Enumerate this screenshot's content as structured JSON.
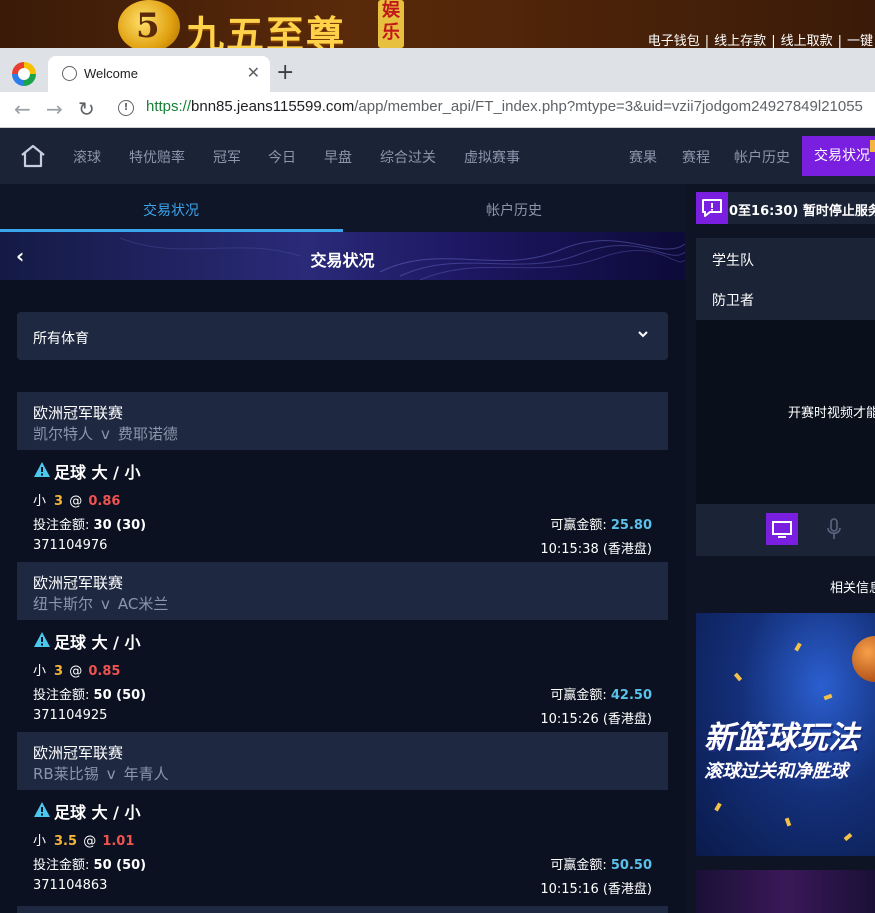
{
  "banner": {
    "logo_char": "5",
    "brand": "九五至尊",
    "brand_tag": [
      "娱",
      "乐"
    ],
    "links": [
      "电子钱包",
      "线上存款",
      "线上取款",
      "一键"
    ]
  },
  "browser": {
    "tab_title": "Welcome",
    "url_scheme": "https://",
    "url_host": "bnn85.jeans115599.com",
    "url_path": "/app/member_api/FT_index.php?mtype=3&uid=vzii7jodgom24927849l21055"
  },
  "nav": {
    "items": [
      "滚球",
      "特优赔率",
      "冠军",
      "今日",
      "早盘",
      "综合过关",
      "虚拟赛事"
    ],
    "right_items": [
      "赛果",
      "赛程",
      "帐户历史"
    ],
    "active": "交易状况"
  },
  "subtabs": {
    "active": "交易状况",
    "other": "帐户历史"
  },
  "page_title": "交易状况",
  "sport_filter": {
    "selected": "所有体育"
  },
  "bets": [
    {
      "league": "欧洲冠军联赛",
      "home": "凯尔特人",
      "vs": "v",
      "away": "费耶诺德",
      "market": "足球 大 / 小",
      "selection": "小",
      "handicap": "3",
      "at": "@",
      "odds": "0.86",
      "stake_label": "投注金额:",
      "stake": "30 (30)",
      "win_label": "可赢金额:",
      "win": "25.80",
      "id": "371104976",
      "time": "10:15:38 (香港盘)"
    },
    {
      "league": "欧洲冠军联赛",
      "home": "纽卡斯尔",
      "vs": "v",
      "away": "AC米兰",
      "market": "足球 大 / 小",
      "selection": "小",
      "handicap": "3",
      "at": "@",
      "odds": "0.85",
      "stake_label": "投注金额:",
      "stake": "50 (50)",
      "win_label": "可赢金额:",
      "win": "42.50",
      "id": "371104925",
      "time": "10:15:26 (香港盘)"
    },
    {
      "league": "欧洲冠军联赛",
      "home": "RB莱比锡",
      "vs": "v",
      "away": "年青人",
      "market": "足球 大 / 小",
      "selection": "小",
      "handicap": "3.5",
      "at": "@",
      "odds": "1.01",
      "stake_label": "投注金额:",
      "stake": "50 (50)",
      "win_label": "可赢金额:",
      "win": "50.50",
      "id": "371104863",
      "time": "10:15:16 (香港盘)"
    }
  ],
  "sidebar": {
    "ticker": "0至16:30) 暂时停止服务",
    "team_a": "学生队",
    "team_b": "防卫者",
    "video_msg": "开赛时视频才能",
    "related": "相关信息",
    "promo_title": "新篮球玩法",
    "promo_sub": "滚球过关和净胜球"
  },
  "colors": {
    "accent": "#7a1ee0",
    "tab_active": "#3aa4ec",
    "odds": "#ef5350",
    "handicap": "#f5b43a",
    "win": "#5bc0ea"
  }
}
